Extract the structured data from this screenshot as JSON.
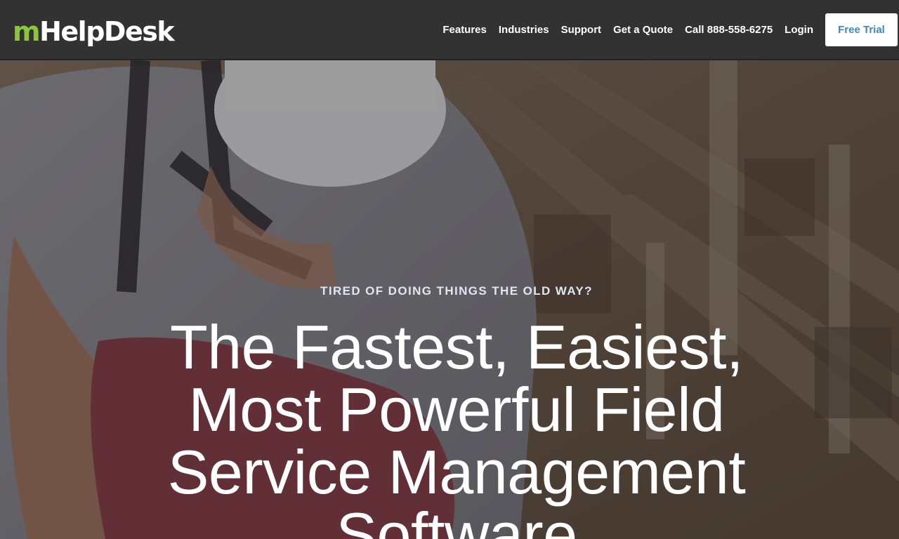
{
  "header": {
    "logo": {
      "m": "m",
      "rest": "HelpDesk"
    },
    "nav": [
      {
        "label": "Features"
      },
      {
        "label": "Industries"
      },
      {
        "label": "Support"
      },
      {
        "label": "Get a Quote"
      },
      {
        "label": "Call 888-558-6275"
      },
      {
        "label": "Login"
      }
    ],
    "cta_label": "Free Trial"
  },
  "hero": {
    "eyebrow": "TIRED OF DOING THINGS THE OLD WAY?",
    "headline": "The Fastest, Easiest, Most Powerful Field Service Management Software"
  },
  "colors": {
    "header_bg": "#323232",
    "logo_accent": "#8cc63f",
    "cta_text": "#3f86c4",
    "eyebrow_text": "#dfe6f2"
  }
}
